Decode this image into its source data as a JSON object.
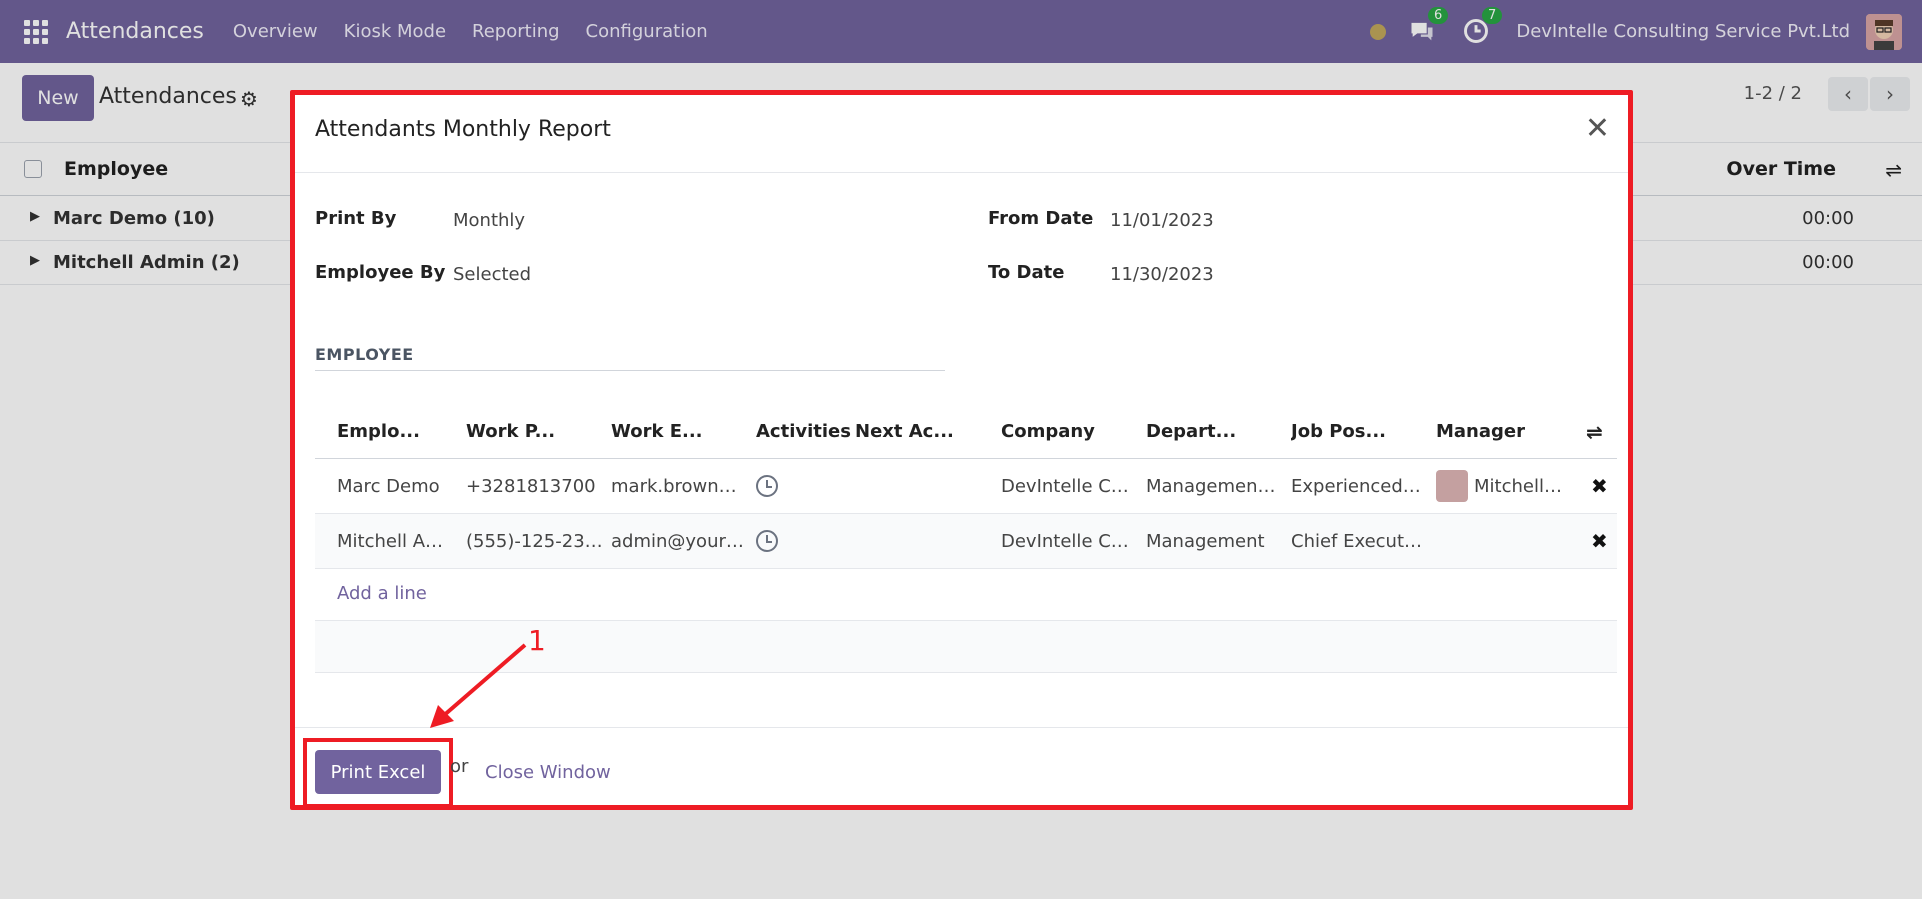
{
  "navbar": {
    "app_name": "Attendances",
    "menu": [
      "Overview",
      "Kiosk Mode",
      "Reporting",
      "Configuration"
    ],
    "messages_count": "6",
    "activities_count": "7",
    "company": "DevIntelle Consulting Service Pvt.Ltd"
  },
  "control": {
    "new_label": "New",
    "title": "Attendances",
    "pager": "1-2 / 2"
  },
  "list": {
    "col_employee": "Employee",
    "col_overtime": "Over Time",
    "groups": [
      {
        "name": "Marc Demo (10)",
        "value": "00:00"
      },
      {
        "name": "Mitchell Admin (2)",
        "value": "00:00"
      }
    ]
  },
  "modal": {
    "title": "Attendants Monthly Report",
    "fields": {
      "print_by_label": "Print By",
      "print_by_value": "Monthly",
      "employee_by_label": "Employee By",
      "employee_by_value": "Selected",
      "from_date_label": "From Date",
      "from_date_value": "11/01/2023",
      "to_date_label": "To Date",
      "to_date_value": "11/30/2023"
    },
    "section": "EMPLOYEE",
    "table": {
      "headers": [
        "Emplo...",
        "Work P...",
        "Work E...",
        "Activities",
        "Next Ac...",
        "Company",
        "Depart...",
        "Job Pos...",
        "Manager"
      ],
      "rows": [
        [
          "Marc Demo",
          "+3281813700",
          "mark.brown…",
          "",
          "",
          "DevIntelle C…",
          "Managemen…",
          "Experienced…",
          "Mitchell…"
        ],
        [
          "Mitchell A…",
          "(555)-125-23…",
          "admin@your…",
          "",
          "",
          "DevIntelle C…",
          "Management",
          "Chief Execut…",
          ""
        ]
      ],
      "add_line": "Add a line"
    },
    "footer": {
      "print_label": "Print Excel",
      "or_label": "or",
      "close_label": "Close Window"
    }
  },
  "annotation": {
    "number": "1"
  },
  "colors": {
    "brand": "#71639e",
    "highlight": "#ee1c24"
  }
}
